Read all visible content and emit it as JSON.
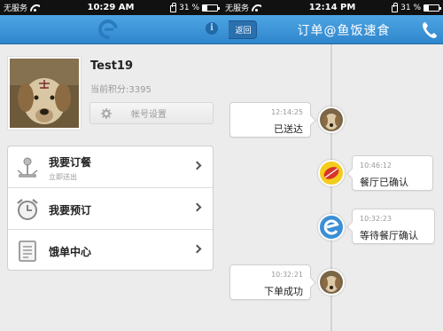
{
  "status_left": {
    "carrier": "无服务",
    "time": "10:29 AM",
    "battery": "31 %",
    "battery_level": 0.31
  },
  "status_right": {
    "carrier": "无服务",
    "time": "12:14 PM",
    "battery": "31 %",
    "battery_level": 0.31
  },
  "header_left": {
    "info_glyph": "i",
    "logo_icon": "e-logo-icon"
  },
  "header_right": {
    "back_label": "返回",
    "title": "订单@鱼饭速食",
    "phone_icon": "phone-icon"
  },
  "profile": {
    "username": "Test19",
    "points": "当前积分:3395",
    "account_settings": "帐号设置"
  },
  "menu": {
    "items": [
      {
        "label": "我要订餐",
        "sub": "立即送出",
        "icon": "joystick-icon"
      },
      {
        "label": "我要预订",
        "sub": "",
        "icon": "alarm-clock-icon"
      },
      {
        "label": "饿单中心",
        "sub": "",
        "icon": "document-icon"
      }
    ]
  },
  "timeline": {
    "events": [
      {
        "time": "12:14:25",
        "status": "已送达",
        "side": "left",
        "avatar": "dog-avatar"
      },
      {
        "time": "10:46:12",
        "status": "餐厅已确认",
        "side": "right",
        "avatar": "restaurant-logo-icon"
      },
      {
        "time": "10:32:23",
        "status": "等待餐厅确认",
        "side": "right",
        "avatar": "e-logo-icon"
      },
      {
        "time": "10:32:21",
        "status": "下单成功",
        "side": "left",
        "avatar": "dog-avatar"
      }
    ]
  },
  "colors": {
    "header_blue": "#3a94d8",
    "background": "#ececec",
    "timeline": "#d4d4d4"
  }
}
